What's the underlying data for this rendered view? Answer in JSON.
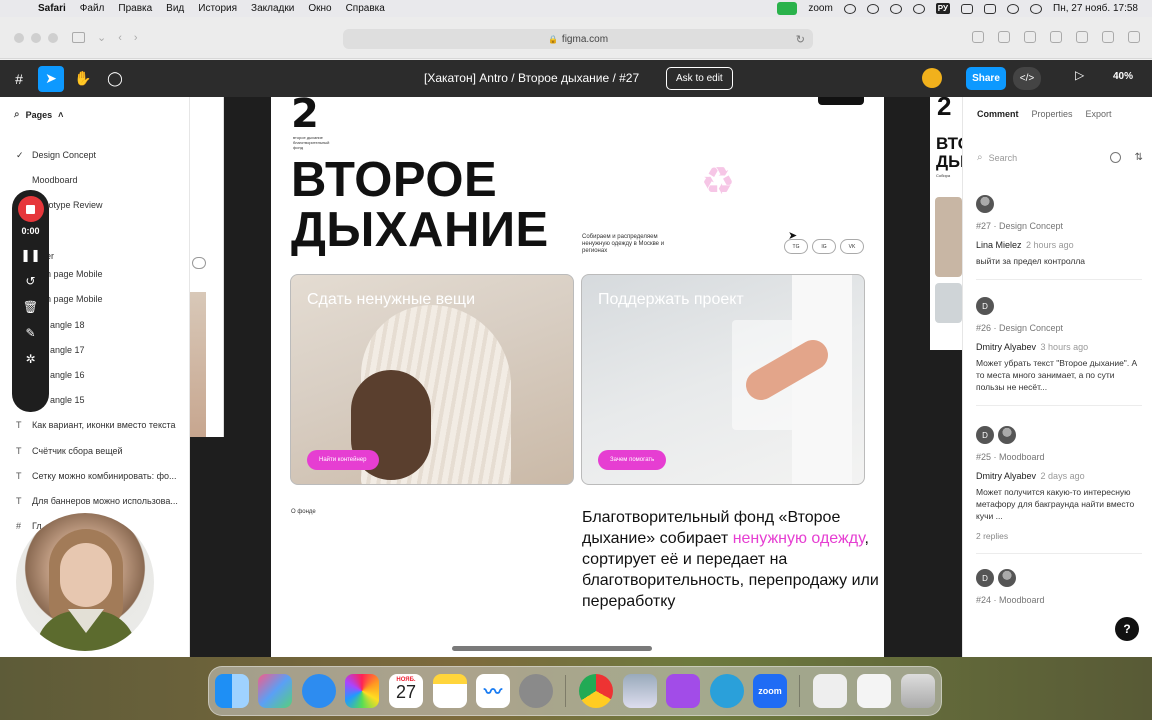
{
  "menubar": {
    "app": "Safari",
    "items": [
      "Файл",
      "Правка",
      "Вид",
      "История",
      "Закладки",
      "Окно",
      "Справка"
    ],
    "zoom_label": "zoom",
    "ru": "РУ",
    "datetime": "Пн, 27 нояб.  17:58"
  },
  "safari": {
    "url": "figma.com"
  },
  "figma": {
    "title": "[Хакатон] Antro / Второе дыхание / #27",
    "ask_to_edit": "Ask to edit",
    "share": "Share",
    "dev": "</>",
    "zoom": "40%"
  },
  "left_panel": {
    "pages_label": "Pages",
    "pages": [
      "Design Concept",
      "Moodboard",
      "Prototype Review"
    ],
    "layers": [
      "er",
      "n page Mobile",
      "n page Mobile",
      "angle 18",
      "angle 17",
      "angle 16",
      "angle 15",
      "Как вариант, иконки вместо текста",
      "Счётчик сбора вещей",
      "Сетку можно комбинировать: фо...",
      "Для баннеров можно использова...",
      "Гл"
    ]
  },
  "recorder": {
    "time": "0:00"
  },
  "design": {
    "logo_n": "2",
    "logo_text": "второе дыхание благотворительный фонд",
    "heading_line1": "ВТОРОЕ",
    "heading_line2": "ДЫХАНИЕ",
    "tagline": "Собираем и распределяем ненужную одежду в Москве и регионах",
    "socials": [
      "TG",
      "IG",
      "VK"
    ],
    "card1_title": "Сдать ненужные вещи",
    "card1_button": "Найти контейнер",
    "card2_title": "Поддержать проект",
    "card2_button": "Зачем помогать",
    "about": "О фонде",
    "body_part1": "Благотворительный фонд «Второе дыхание» собирает ",
    "body_highlight": "ненужную одежду",
    "body_part2": ", сортирует её и передает на благотворительность, перепродажу или переработку",
    "right_frame_n": "2",
    "right_frame_head": "ВТО ДЫ",
    "right_frame_small": "Собира",
    "accent_color": "#e63ed2"
  },
  "right_panel": {
    "tabs": [
      "Comment",
      "Properties",
      "Export"
    ],
    "search_placeholder": "Search",
    "comments": [
      {
        "ref": "#27 · Design Concept",
        "author": "Lina Mielez",
        "time": "2 hours ago",
        "text": "выйти за предел контролла",
        "avatars": [
          ""
        ],
        "replies": ""
      },
      {
        "ref": "#26 · Design Concept",
        "author": "Dmitry Alyabev",
        "time": "3 hours ago",
        "text": "Может убрать текст \"Второе дыхание\". А то места много занимает, а по сути пользы не несёт...",
        "avatars": [
          "D"
        ],
        "replies": ""
      },
      {
        "ref": "#25 · Moodboard",
        "author": "Dmitry Alyabev",
        "time": "2 days ago",
        "text": "Может получится какую-то интересную метафору для бакграунда найти вместо кучи ...",
        "avatars": [
          "D",
          ""
        ],
        "replies": "2 replies"
      },
      {
        "ref": "#24 · Moodboard",
        "author": "",
        "time": "",
        "text": "",
        "avatars": [
          "D",
          ""
        ],
        "replies": ""
      }
    ],
    "help": "?"
  },
  "dock": {
    "calendar_month": "НОЯБ.",
    "calendar_day": "27",
    "zoom_label": "zoom"
  }
}
